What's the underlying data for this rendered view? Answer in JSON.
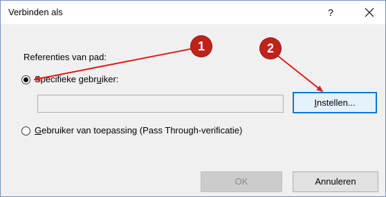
{
  "window": {
    "title": "Verbinden als",
    "help_label": "?",
    "close_icon": "close-icon"
  },
  "form": {
    "group_label": "Referenties van pad:",
    "option_specific": {
      "label_before": "Specifieke gebr",
      "label_accel": "u",
      "label_after": "iker:",
      "checked": true
    },
    "user_field_value": "",
    "option_passthrough": {
      "label_before": "",
      "label_accel": "G",
      "label_after": "ebruiker van toepassing (Pass Through-verificatie)",
      "checked": false
    }
  },
  "buttons": {
    "instellen_accel": "I",
    "instellen_rest": "nstellen...",
    "ok_label": "OK",
    "ok_enabled": false,
    "cancel_label": "Annuleren"
  },
  "annotations": {
    "badge1": "1",
    "badge2": "2",
    "color": "#c0221b"
  }
}
